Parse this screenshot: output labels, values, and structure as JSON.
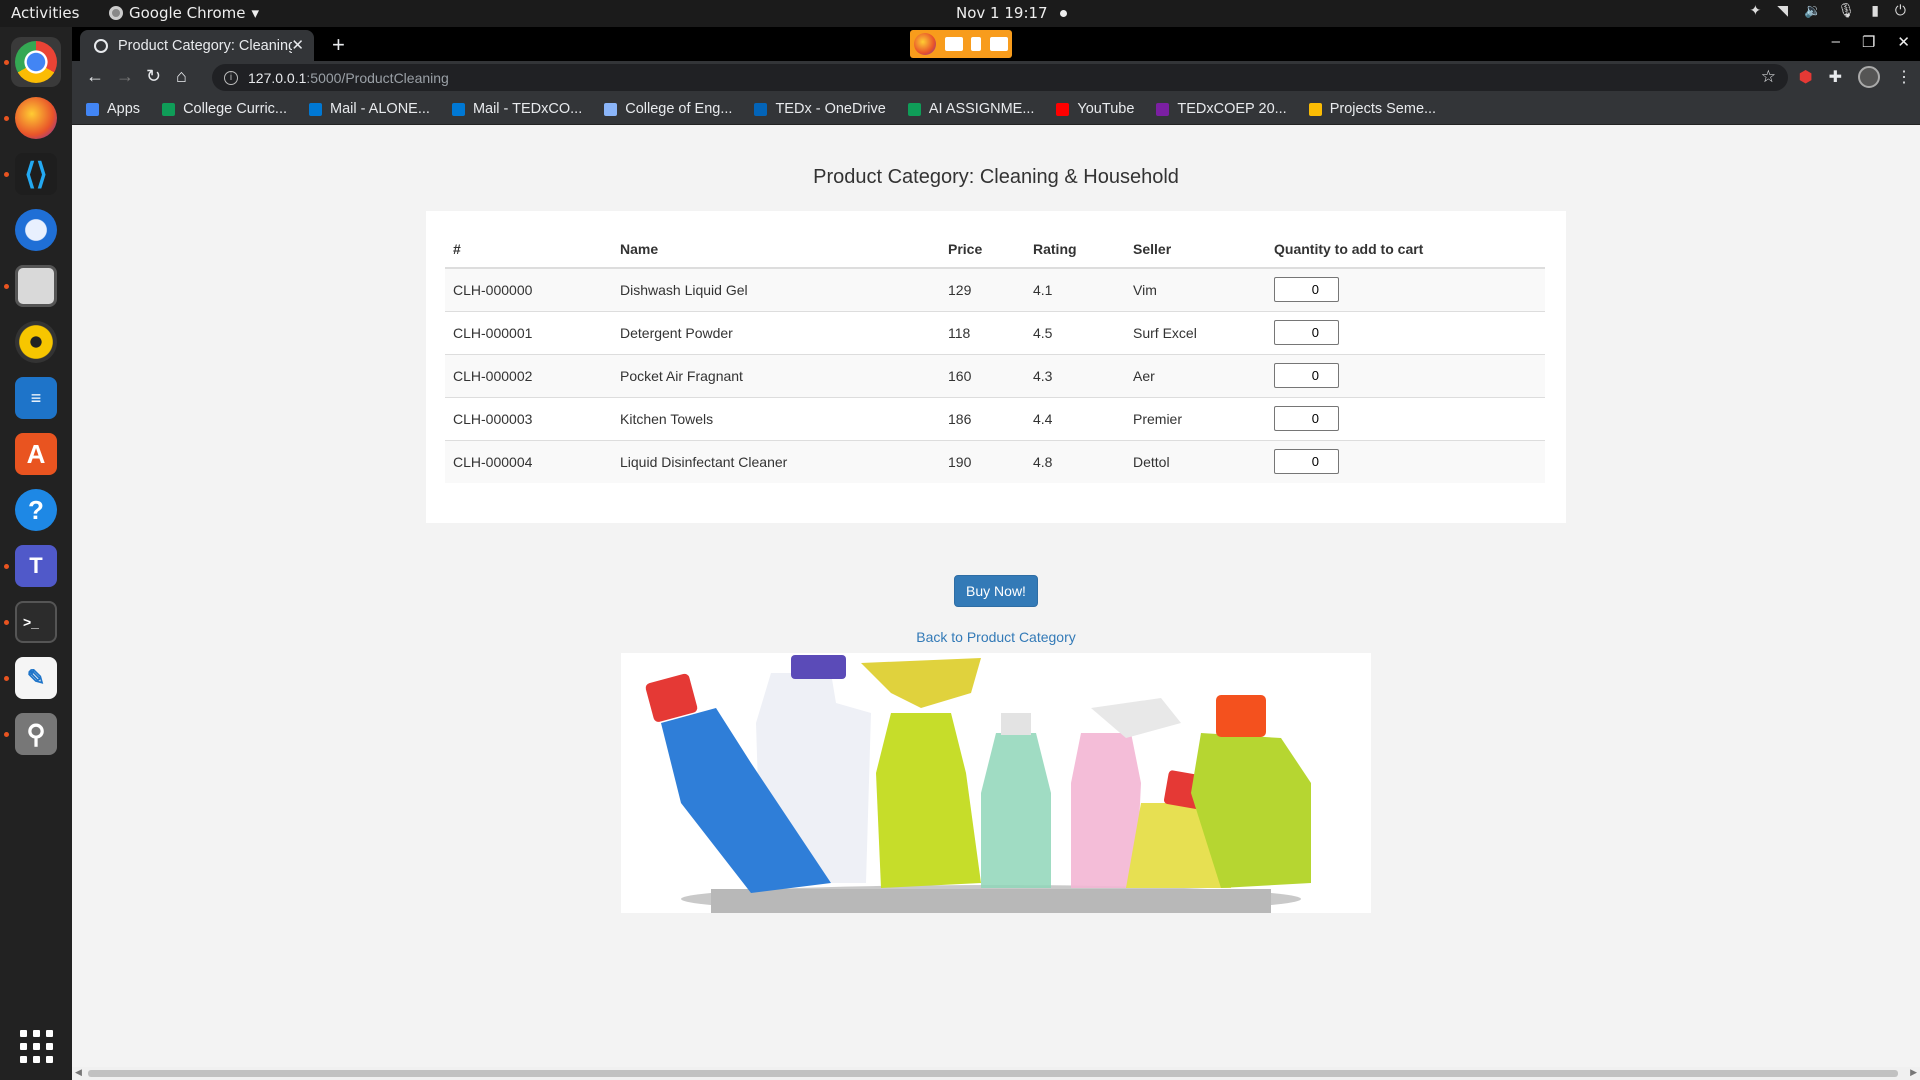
{
  "topbar": {
    "activities": "Activities",
    "app_name": "Google Chrome",
    "clock": "Nov 1  19:17"
  },
  "dock": {
    "apps": [
      "chrome",
      "firefox",
      "vscode",
      "thunderbird",
      "files",
      "rhythmbox",
      "writer",
      "software",
      "help",
      "teams",
      "terminal",
      "text-editor",
      "search"
    ]
  },
  "browser": {
    "tab_title": "Product Category: Cleaning & Household",
    "url_host": "127.0.0.1",
    "url_path": ":5000/ProductCleaning",
    "bookmarks": [
      {
        "label": "Apps",
        "color": "#4285f4"
      },
      {
        "label": "College Curric...",
        "color": "#0f9d58"
      },
      {
        "label": "Mail - ALONE...",
        "color": "#0078d4"
      },
      {
        "label": "Mail - TEDxCO...",
        "color": "#0078d4"
      },
      {
        "label": "College of Eng...",
        "color": "#8ab4f8"
      },
      {
        "label": "TEDx - OneDrive",
        "color": "#0364b8"
      },
      {
        "label": "AI ASSIGNME...",
        "color": "#0f9d58"
      },
      {
        "label": "YouTube",
        "color": "#ff0000"
      },
      {
        "label": "TEDxCOEP 20...",
        "color": "#7b1fa2"
      },
      {
        "label": "Projects Seme...",
        "color": "#fbbc04"
      }
    ]
  },
  "page": {
    "title": "Product Category: Cleaning & Household",
    "columns": [
      "#",
      "Name",
      "Price",
      "Rating",
      "Seller",
      "Quantity to add to cart"
    ],
    "rows": [
      {
        "id": "CLH-000000",
        "name": "Dishwash Liquid Gel",
        "price": "129",
        "rating": "4.1",
        "seller": "Vim",
        "qty": "0"
      },
      {
        "id": "CLH-000001",
        "name": "Detergent Powder",
        "price": "118",
        "rating": "4.5",
        "seller": "Surf Excel",
        "qty": "0"
      },
      {
        "id": "CLH-000002",
        "name": "Pocket Air Fragnant",
        "price": "160",
        "rating": "4.3",
        "seller": "Aer",
        "qty": "0"
      },
      {
        "id": "CLH-000003",
        "name": "Kitchen Towels",
        "price": "186",
        "rating": "4.4",
        "seller": "Premier",
        "qty": "0"
      },
      {
        "id": "CLH-000004",
        "name": "Liquid Disinfectant Cleaner",
        "price": "190",
        "rating": "4.8",
        "seller": "Dettol",
        "qty": "0"
      }
    ],
    "buy_button": "Buy Now!",
    "back_link": "Back to Product Category"
  }
}
